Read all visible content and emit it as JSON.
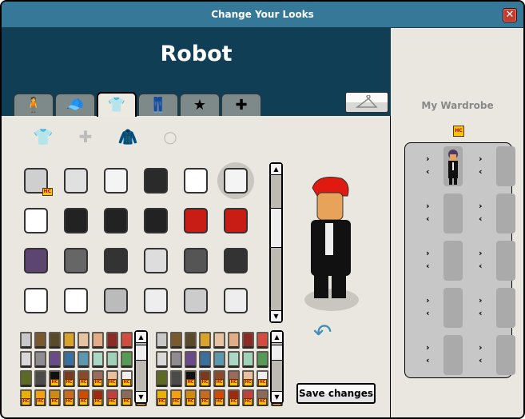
{
  "window": {
    "title": "Change Your Looks",
    "close_label": "✕"
  },
  "figure_name": "Robot",
  "tabs": [
    {
      "name": "body",
      "icon": "body-icon",
      "glyph": "🧍",
      "active": false
    },
    {
      "name": "head",
      "icon": "cap-icon",
      "glyph": "🧢",
      "active": false
    },
    {
      "name": "torso",
      "icon": "shirt-icon",
      "glyph": "👕",
      "active": true
    },
    {
      "name": "legs",
      "icon": "pants-icon",
      "glyph": "👖",
      "active": false
    },
    {
      "name": "special",
      "icon": "star-icon",
      "glyph": "★",
      "active": false
    },
    {
      "name": "effects",
      "icon": "figure-plus-icon",
      "glyph": "✚",
      "active": false
    }
  ],
  "wardrobe_button": {
    "icon": "hanger-icon",
    "glyph": "⌂"
  },
  "subcategories": [
    {
      "name": "shirt",
      "glyph": "👕",
      "selected": true
    },
    {
      "name": "shirt-accessory",
      "glyph": "✚",
      "selected": false
    },
    {
      "name": "jacket",
      "glyph": "🧥",
      "selected": false
    },
    {
      "name": "necklace",
      "glyph": "○",
      "selected": false
    }
  ],
  "items": [
    {
      "color": "#cfcfcf",
      "hc": true
    },
    {
      "color": "#e0e0e0"
    },
    {
      "color": "#f4f4f4"
    },
    {
      "color": "#2a2a2a"
    },
    {
      "color": "#ffffff"
    },
    {
      "color": "#f4f4f4",
      "selected": true
    },
    {
      "color": "#ffffff"
    },
    {
      "color": "#222222"
    },
    {
      "color": "#222222"
    },
    {
      "color": "#222222"
    },
    {
      "color": "#c81d14"
    },
    {
      "color": "#c81d14"
    },
    {
      "color": "#5c4670"
    },
    {
      "color": "#666666"
    },
    {
      "color": "#333333"
    },
    {
      "color": "#dddddd"
    },
    {
      "color": "#555555"
    },
    {
      "color": "#333333"
    },
    {
      "color": "#ffffff"
    },
    {
      "color": "#ffffff"
    },
    {
      "color": "#bbbbbb"
    },
    {
      "color": "#eeeeee"
    },
    {
      "color": "#cccccc"
    },
    {
      "color": "#eeeeee"
    }
  ],
  "palette_1": [
    {
      "c": "#c8c8c8"
    },
    {
      "c": "#7a5a2c"
    },
    {
      "c": "#5a4a2a"
    },
    {
      "c": "#d9a22a"
    },
    {
      "c": "#e8c3a2"
    },
    {
      "c": "#e0ad84"
    },
    {
      "c": "#8e2a25"
    },
    {
      "c": "#d44c3f"
    },
    {
      "c": "#ead2c0"
    },
    {
      "c": "#d8d8d8"
    },
    {
      "c": "#8f8b92"
    },
    {
      "c": "#6a4a8a"
    },
    {
      "c": "#3a70a0"
    },
    {
      "c": "#5b98b0"
    },
    {
      "c": "#a9d8c6"
    },
    {
      "c": "#9fd0b8"
    },
    {
      "c": "#559a55"
    },
    {
      "c": "#2f5a2f"
    },
    {
      "c": "#5c6a22",
      "hc": false
    },
    {
      "c": "#4b4b4b",
      "hc": false
    },
    {
      "c": "#111111",
      "hc": true
    },
    {
      "c": "#7a3a20",
      "hc": true
    },
    {
      "c": "#8a4a2a",
      "hc": true
    },
    {
      "c": "#9a6a5a",
      "hc": true
    },
    {
      "c": "#e8c0a0",
      "hc": true
    },
    {
      "c": "#eeeeee",
      "hc": true
    },
    {
      "c": "#f4c211",
      "hc": true
    },
    {
      "c": "#e8b000",
      "hc": true
    },
    {
      "c": "#f0a010",
      "hc": true
    },
    {
      "c": "#d08a10",
      "hc": true
    },
    {
      "c": "#c86a20",
      "hc": true
    },
    {
      "c": "#d04a00",
      "hc": true
    },
    {
      "c": "#a02a10",
      "hc": true
    },
    {
      "c": "#c04040",
      "hc": true
    },
    {
      "c": "#8a6a5a",
      "hc": true
    },
    {
      "c": "#8a2a2a",
      "hc": true
    }
  ],
  "palette_2": [
    {
      "c": "#c8c8c8"
    },
    {
      "c": "#7a5a2c"
    },
    {
      "c": "#5a4a2a"
    },
    {
      "c": "#d9a22a"
    },
    {
      "c": "#e8c3a2"
    },
    {
      "c": "#e0ad84"
    },
    {
      "c": "#8e2a25"
    },
    {
      "c": "#d44c3f"
    },
    {
      "c": "#ead2c0"
    },
    {
      "c": "#d8d8d8"
    },
    {
      "c": "#8f8b92"
    },
    {
      "c": "#6a4a8a"
    },
    {
      "c": "#3a70a0"
    },
    {
      "c": "#5b98b0"
    },
    {
      "c": "#a9d8c6"
    },
    {
      "c": "#9fd0b8"
    },
    {
      "c": "#559a55"
    },
    {
      "c": "#2f5a2f"
    },
    {
      "c": "#5c6a22",
      "hc": false
    },
    {
      "c": "#4b4b4b",
      "hc": false
    },
    {
      "c": "#111111",
      "hc": true
    },
    {
      "c": "#7a3a20",
      "hc": true
    },
    {
      "c": "#8a4a2a",
      "hc": true
    },
    {
      "c": "#9a6a5a",
      "hc": true
    },
    {
      "c": "#e8c0a0",
      "hc": true
    },
    {
      "c": "#eeeeee",
      "hc": true
    },
    {
      "c": "#f4c211",
      "hc": true
    },
    {
      "c": "#e8b000",
      "hc": true
    },
    {
      "c": "#f0a010",
      "hc": true
    },
    {
      "c": "#d08a10",
      "hc": true
    },
    {
      "c": "#c86a20",
      "hc": true
    },
    {
      "c": "#d04a00",
      "hc": true
    },
    {
      "c": "#a02a10",
      "hc": true
    },
    {
      "c": "#c04040",
      "hc": true
    },
    {
      "c": "#8a6a5a",
      "hc": true
    },
    {
      "c": "#8a2a2a",
      "hc": true
    }
  ],
  "hc_badge": "HC",
  "save_label": "Save changes",
  "wardrobe": {
    "title": "My Wardrobe",
    "hc_badge": "HC",
    "slots": 10,
    "filled_slots": [
      0
    ],
    "next_glyph": "›",
    "prev_glyph": "‹"
  }
}
